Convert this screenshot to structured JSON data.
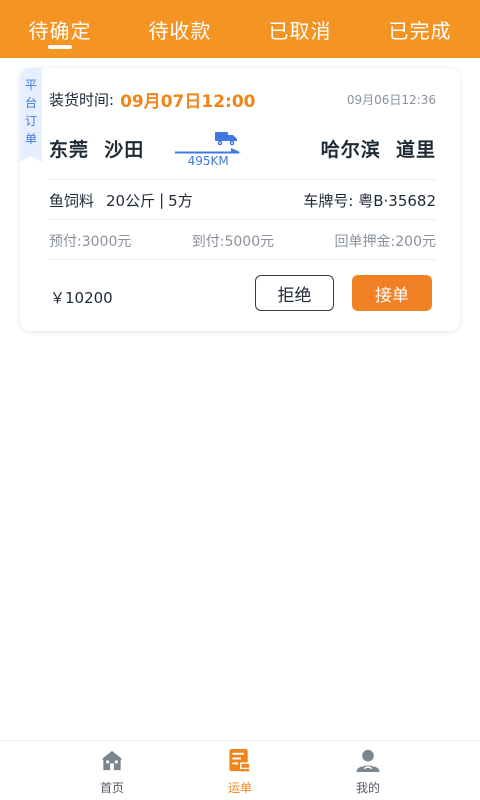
{
  "tabs": [
    {
      "label": "待确定",
      "active": true
    },
    {
      "label": "待收款",
      "active": false
    },
    {
      "label": "已取消",
      "active": false
    },
    {
      "label": "已完成",
      "active": false
    }
  ],
  "order": {
    "platform_tag": [
      "平",
      "台",
      "订",
      "单"
    ],
    "load_time_label": "装货时间:",
    "load_time_value": "09月07日12:00",
    "created_time": "09月06日12:36",
    "origin": "东莞  沙田",
    "destination": "哈尔滨  道里",
    "distance": "495KM",
    "cargo_name": "鱼饲料",
    "cargo_weight": "20公斤",
    "cargo_separator": "|",
    "cargo_volume": "5方",
    "plate_label": "车牌号:",
    "plate_value": "粤B·35682",
    "prepay_label": "预付:",
    "prepay_value": "3000元",
    "arrival_pay_label": "到付:",
    "arrival_pay_value": "5000元",
    "receipt_deposit_label": "回单押金:",
    "receipt_deposit_value": "200元",
    "price": "￥10200",
    "reject_label": "拒绝",
    "accept_label": "接单"
  },
  "bottom_nav": [
    {
      "label": "首页",
      "icon": "home-icon",
      "active": false
    },
    {
      "label": "运单",
      "icon": "waybill-icon",
      "active": true
    },
    {
      "label": "我的",
      "icon": "user-icon",
      "active": false
    }
  ],
  "colors": {
    "brand_orange": "#f39423",
    "accent_orange": "#f08519",
    "accept_button": "#f28024",
    "route_blue": "#3f78e0",
    "tag_background": "#e5efff"
  }
}
